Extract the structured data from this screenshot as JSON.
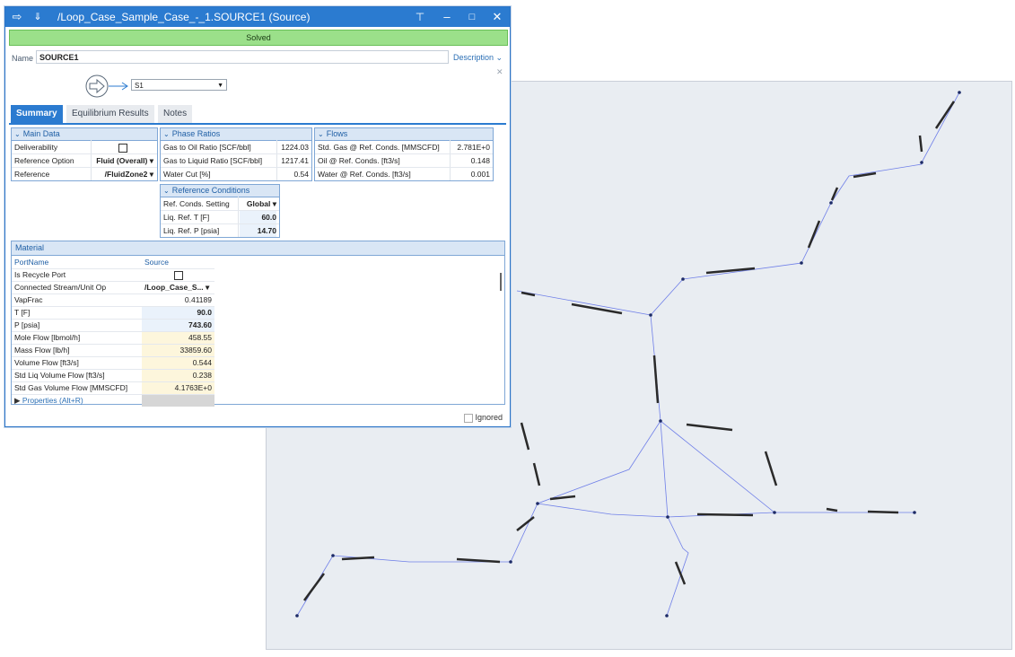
{
  "window": {
    "title": "/Loop_Case_Sample_Case_-_1.SOURCE1 (Source)",
    "status": "Solved"
  },
  "name": {
    "label": "Name",
    "value": "SOURCE1",
    "description_label": "Description"
  },
  "stream_select": {
    "value": "S1"
  },
  "tabs": [
    "Summary",
    "Equilibrium Results",
    "Notes"
  ],
  "main_data": {
    "title": "Main Data",
    "rows": [
      {
        "label": "Deliverability",
        "value": ""
      },
      {
        "label": "Reference Option",
        "value": "Fluid (Overall)"
      },
      {
        "label": "Reference",
        "value": "/FluidZone2"
      }
    ]
  },
  "phase_ratios": {
    "title": "Phase Ratios",
    "rows": [
      {
        "label": "Gas to Oil Ratio [SCF/bbl]",
        "value": "1224.03"
      },
      {
        "label": "Gas to Liquid Ratio [SCF/bbl]",
        "value": "1217.41"
      },
      {
        "label": "Water Cut [%]",
        "value": "0.54"
      }
    ]
  },
  "flows": {
    "title": "Flows",
    "rows": [
      {
        "label": "Std. Gas @ Ref. Conds. [MMSCFD]",
        "value": "2.781E+0"
      },
      {
        "label": "Oil @ Ref. Conds. [ft3/s]",
        "value": "0.148"
      },
      {
        "label": "Water @ Ref. Conds. [ft3/s]",
        "value": "0.001"
      }
    ]
  },
  "ref_conditions": {
    "title": "Reference Conditions",
    "rows": [
      {
        "label": "Ref. Conds. Setting",
        "value": "Global"
      },
      {
        "label": "Liq. Ref. T [F]",
        "value": "60.0"
      },
      {
        "label": "Liq. Ref. P [psia]",
        "value": "14.70"
      }
    ]
  },
  "material": {
    "title": "Material",
    "header": {
      "label": "PortName",
      "value": "Source"
    },
    "rows": [
      {
        "label": "Is Recycle Port",
        "value": ""
      },
      {
        "label": "Connected Stream/Unit Op",
        "value": "/Loop_Case_S..."
      },
      {
        "label": "VapFrac",
        "value": "0.41189"
      },
      {
        "label": "T [F]",
        "value": "90.0"
      },
      {
        "label": "P [psia]",
        "value": "743.60"
      },
      {
        "label": "Mole Flow [lbmol/h]",
        "value": "458.55"
      },
      {
        "label": "Mass Flow [lb/h]",
        "value": "33859.60"
      },
      {
        "label": "Volume Flow [ft3/s]",
        "value": "0.544"
      },
      {
        "label": "Std Liq Volume Flow [ft3/s]",
        "value": "0.238"
      },
      {
        "label": "Std Gas Volume Flow [MMSCFD]",
        "value": "4.1763E+0"
      }
    ],
    "properties_label": "Properties",
    "properties_shortcut": "(Alt+R)"
  },
  "ignored_label": "Ignored"
}
